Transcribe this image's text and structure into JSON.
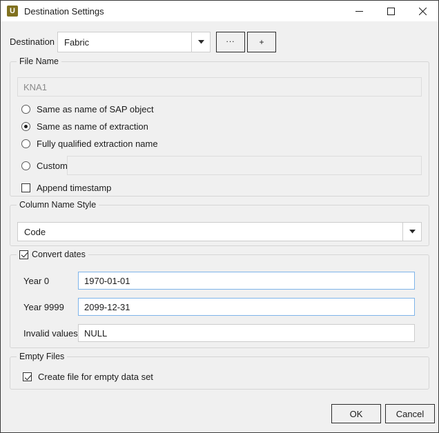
{
  "window": {
    "title": "Destination Settings",
    "icon_letter": "U",
    "icon_name": "app-icon-u",
    "icon_color": "#80711f",
    "controls": {
      "minimize": "minimize-icon",
      "maximize": "maximize-icon",
      "close": "close-icon"
    }
  },
  "destination": {
    "label": "Destination",
    "value": "Fabric",
    "dropdown_icon": "chevron-down-icon",
    "browse_button": "...",
    "add_button": "+"
  },
  "file_name": {
    "group_title": "File Name",
    "filename_value": "KNA1",
    "filename_disabled": true,
    "options": [
      {
        "label": "Same as name of SAP object",
        "selected": false
      },
      {
        "label": "Same as name of extraction",
        "selected": true
      },
      {
        "label": "Fully qualified extraction name",
        "selected": false
      },
      {
        "label": "Custom",
        "selected": false
      }
    ],
    "custom_value": "",
    "custom_placeholder": "",
    "append_timestamp": {
      "label": "Append timestamp",
      "checked": false
    }
  },
  "column_name_style": {
    "group_title": "Column Name Style",
    "value": "Code",
    "dropdown_icon": "chevron-down-icon"
  },
  "convert_dates": {
    "group_title": "Convert dates",
    "checked": true,
    "rows": [
      {
        "label": "Year 0",
        "value": "1970-01-01",
        "highlight": true
      },
      {
        "label": "Year 9999",
        "value": "2099-12-31",
        "highlight": true
      },
      {
        "label": "Invalid values",
        "value": "NULL",
        "highlight": false
      }
    ]
  },
  "empty_files": {
    "group_title": "Empty Files",
    "checkbox": {
      "label": "Create file for empty data set",
      "checked": true
    }
  },
  "footer": {
    "ok_label": "OK",
    "cancel_label": "Cancel"
  },
  "colors": {
    "dialog_bg": "#f0f0f0",
    "titlebar_bg": "#ffffff",
    "accent_highlight": "#7eb4ea",
    "group_border": "#d5d5d5"
  }
}
